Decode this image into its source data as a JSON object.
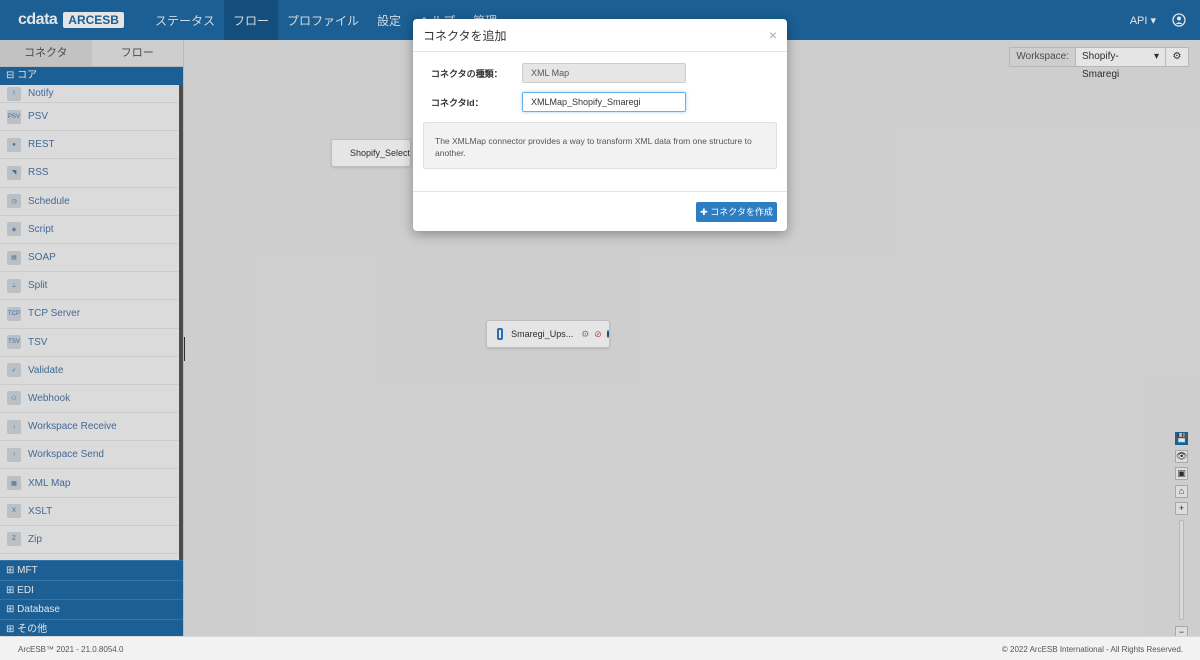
{
  "brand": {
    "cdata": "cdata",
    "arcesb": "ARCESB"
  },
  "nav": [
    "ステータス",
    "フロー",
    "プロファイル",
    "設定",
    "ヘルプ",
    "管理"
  ],
  "topright": {
    "api": "API ▾"
  },
  "sidebar": {
    "tabs": [
      "コネクタ",
      "フロー"
    ],
    "category_open": "⊟ コア",
    "items": [
      {
        "label": "Notify",
        "icon": "!"
      },
      {
        "label": "PSV",
        "icon": "PSV"
      },
      {
        "label": "REST",
        "icon": "●"
      },
      {
        "label": "RSS",
        "icon": "◥"
      },
      {
        "label": "Schedule",
        "icon": "◷"
      },
      {
        "label": "Script",
        "icon": "◈"
      },
      {
        "label": "SOAP",
        "icon": "▤"
      },
      {
        "label": "Split",
        "icon": "⊥"
      },
      {
        "label": "TCP Server",
        "icon": "TCP"
      },
      {
        "label": "TSV",
        "icon": "TSV"
      },
      {
        "label": "Validate",
        "icon": "✓"
      },
      {
        "label": "Webhook",
        "icon": "⚇"
      },
      {
        "label": "Workspace Receive",
        "icon": "↓"
      },
      {
        "label": "Workspace Send",
        "icon": "↑"
      },
      {
        "label": "XML Map",
        "icon": "▦"
      },
      {
        "label": "XSLT",
        "icon": "X"
      },
      {
        "label": "Zip",
        "icon": "Z"
      }
    ],
    "collapsed_categories": [
      "⊞ MFT",
      "⊞ EDI",
      "⊞ Database",
      "⊞ その他"
    ]
  },
  "workspace": {
    "label": "Workspace:",
    "value": "Shopify-Smaregi"
  },
  "nodes": {
    "shopify": "Shopify_Select",
    "smaregi": "Smaregi_Ups..."
  },
  "tools": [
    "💾",
    "👁",
    "▣",
    "⌂",
    "+",
    "−"
  ],
  "modal": {
    "title": "コネクタを追加",
    "close": "×",
    "type_label": "コネクタの種類：",
    "type_value": "XML Map",
    "id_label": "コネクタId：",
    "id_value": "XMLMap_Shopify_Smaregi",
    "description": "The XMLMap connector provides a way to transform XML data from one structure to another.",
    "create_button": "✚ コネクタを作成"
  },
  "footer": {
    "version": "ArcESB™ 2021 - 21.0.8054.0",
    "copyright": "© 2022 ArcESB International - All Rights Reserved."
  }
}
